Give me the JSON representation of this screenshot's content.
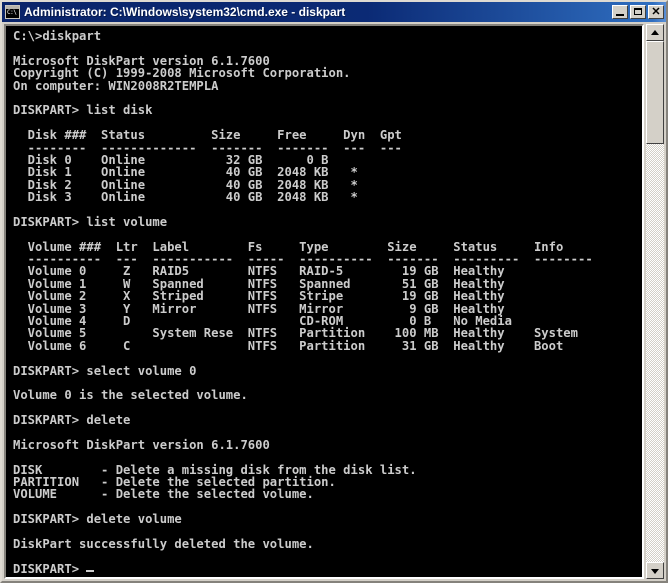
{
  "window": {
    "title": "Administrator: C:\\Windows\\system32\\cmd.exe - diskpart",
    "icon_glyph": "C:\\",
    "minimize_label": "Minimize",
    "maximize_label": "Maximize",
    "close_label": "Close"
  },
  "scrollbar": {
    "up_label": "Scroll up",
    "down_label": "Scroll down",
    "thumb_label": "Scroll thumb"
  },
  "console": {
    "prompt": "DISKPART>",
    "cursor": "_",
    "lines": [
      "C:\\>diskpart",
      "",
      "Microsoft DiskPart version 6.1.7600",
      "Copyright (C) 1999-2008 Microsoft Corporation.",
      "On computer: WIN2008R2TEMPLA",
      "",
      "DISKPART> list disk",
      "",
      "  Disk ###  Status         Size     Free     Dyn  Gpt",
      "  --------  -------------  -------  -------  ---  ---",
      "  Disk 0    Online           32 GB      0 B",
      "  Disk 1    Online           40 GB  2048 KB   *",
      "  Disk 2    Online           40 GB  2048 KB   *",
      "  Disk 3    Online           40 GB  2048 KB   *",
      "",
      "DISKPART> list volume",
      "",
      "  Volume ###  Ltr  Label        Fs     Type        Size     Status     Info",
      "  ----------  ---  -----------  -----  ----------  -------  ---------  --------",
      "  Volume 0     Z   RAID5        NTFS   RAID-5        19 GB  Healthy",
      "  Volume 1     W   Spanned      NTFS   Spanned       51 GB  Healthy",
      "  Volume 2     X   Striped      NTFS   Stripe        19 GB  Healthy",
      "  Volume 3     Y   Mirror       NTFS   Mirror         9 GB  Healthy",
      "  Volume 4     D                       CD-ROM         0 B   No Media",
      "  Volume 5         System Rese  NTFS   Partition    100 MB  Healthy    System",
      "  Volume 6     C                NTFS   Partition     31 GB  Healthy    Boot",
      "",
      "DISKPART> select volume 0",
      "",
      "Volume 0 is the selected volume.",
      "",
      "DISKPART> delete",
      "",
      "Microsoft DiskPart version 6.1.7600",
      "",
      "DISK        - Delete a missing disk from the disk list.",
      "PARTITION   - Delete the selected partition.",
      "VOLUME      - Delete the selected volume.",
      "",
      "DISKPART> delete volume",
      "",
      "DiskPart successfully deleted the volume.",
      ""
    ],
    "disk_table": {
      "headers": [
        "Disk ###",
        "Status",
        "Size",
        "Free",
        "Dyn",
        "Gpt"
      ],
      "rows": [
        [
          "Disk 0",
          "Online",
          "32 GB",
          "0 B",
          "",
          ""
        ],
        [
          "Disk 1",
          "Online",
          "40 GB",
          "2048 KB",
          "*",
          ""
        ],
        [
          "Disk 2",
          "Online",
          "40 GB",
          "2048 KB",
          "*",
          ""
        ],
        [
          "Disk 3",
          "Online",
          "40 GB",
          "2048 KB",
          "*",
          ""
        ]
      ]
    },
    "volume_table": {
      "headers": [
        "Volume ###",
        "Ltr",
        "Label",
        "Fs",
        "Type",
        "Size",
        "Status",
        "Info"
      ],
      "rows": [
        [
          "Volume 0",
          "Z",
          "RAID5",
          "NTFS",
          "RAID-5",
          "19 GB",
          "Healthy",
          ""
        ],
        [
          "Volume 1",
          "W",
          "Spanned",
          "NTFS",
          "Spanned",
          "51 GB",
          "Healthy",
          ""
        ],
        [
          "Volume 2",
          "X",
          "Striped",
          "NTFS",
          "Stripe",
          "19 GB",
          "Healthy",
          ""
        ],
        [
          "Volume 3",
          "Y",
          "Mirror",
          "NTFS",
          "Mirror",
          "9 GB",
          "Healthy",
          ""
        ],
        [
          "Volume 4",
          "D",
          "",
          "",
          "CD-ROM",
          "0 B",
          "No Media",
          ""
        ],
        [
          "Volume 5",
          "",
          "System Rese",
          "NTFS",
          "Partition",
          "100 MB",
          "Healthy",
          "System"
        ],
        [
          "Volume 6",
          "C",
          "",
          "NTFS",
          "Partition",
          "31 GB",
          "Healthy",
          "Boot"
        ]
      ]
    },
    "commands": [
      "diskpart",
      "list disk",
      "list volume",
      "select volume 0",
      "delete",
      "delete volume"
    ],
    "version": "Microsoft DiskPart version 6.1.7600",
    "copyright": "Copyright (C) 1999-2008 Microsoft Corporation.",
    "computer": "On computer: WIN2008R2TEMPLA",
    "selected_message": "Volume 0 is the selected volume.",
    "success_message": "DiskPart successfully deleted the volume."
  },
  "colors": {
    "console_bg": "#000000",
    "console_fg": "#cccccc",
    "titlebar_start": "#0a246a",
    "titlebar_end": "#5a8fd6",
    "chrome": "#d4d0c8"
  }
}
